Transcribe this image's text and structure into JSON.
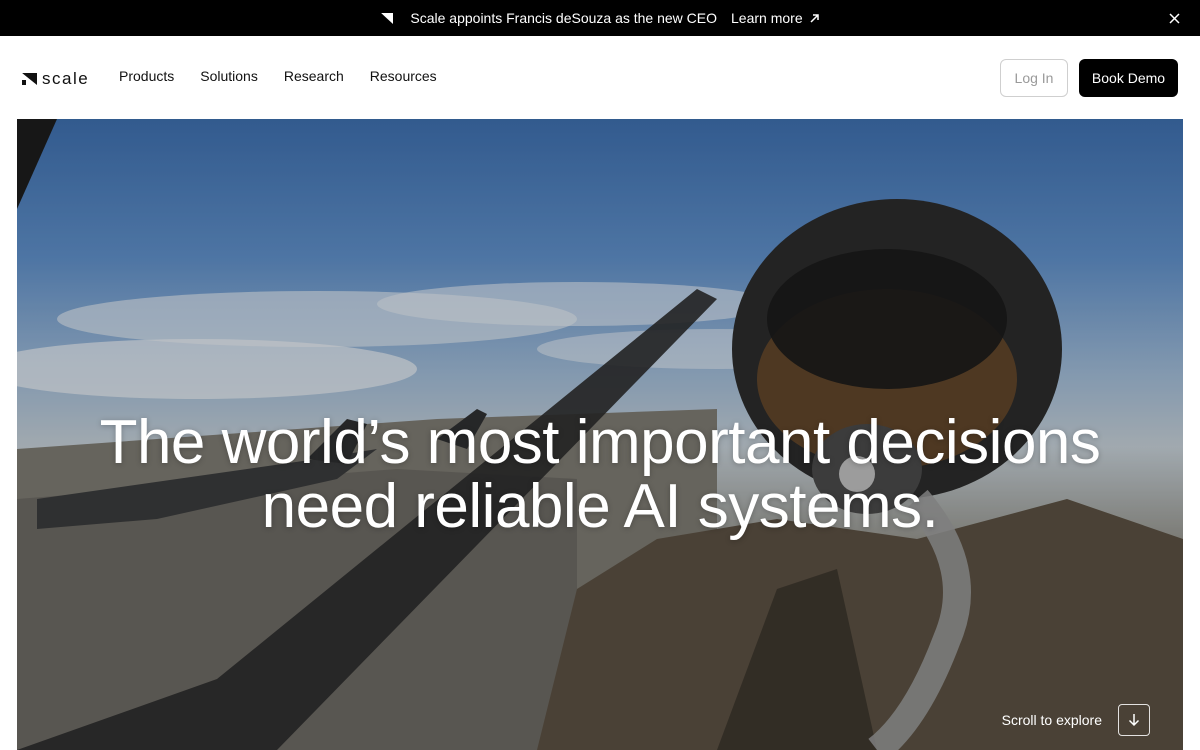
{
  "announcement": {
    "text": "Scale appoints Francis deSouza as the new CEO",
    "link_label": "Learn more",
    "icons": {
      "brand": "scale-logo-icon",
      "link": "arrow-up-right-icon",
      "close": "close-icon"
    }
  },
  "nav": {
    "brand_name": "scale",
    "links": [
      "Products",
      "Solutions",
      "Research",
      "Resources"
    ],
    "login_label": "Log In",
    "demo_label": "Book Demo"
  },
  "hero": {
    "headline_line1": "The world’s most important decisions",
    "headline_line2": "need reliable AI systems.",
    "scroll_label": "Scroll to explore",
    "scroll_icon": "arrow-down-icon"
  },
  "colors": {
    "announcement_bg": "#000000",
    "demo_button_bg": "#000000",
    "login_text": "#9a9a9a",
    "hero_text": "#ffffff"
  }
}
